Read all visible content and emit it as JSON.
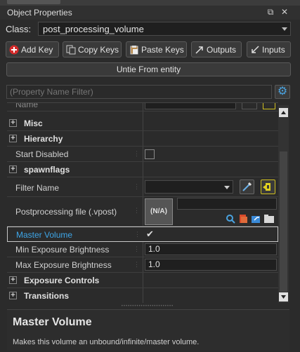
{
  "window": {
    "title": "Object Properties"
  },
  "class_row": {
    "label": "Class:",
    "value": "post_processing_volume"
  },
  "toolbar": {
    "add_key": "Add Key",
    "copy_keys": "Copy Keys",
    "paste_keys": "Paste Keys",
    "outputs": "Outputs",
    "inputs": "Inputs"
  },
  "untie_label": "Untie From entity",
  "filter": {
    "placeholder": "(Property Name Filter)"
  },
  "properties": {
    "cut_top_label": "Name",
    "misc": "Misc",
    "hierarchy": "Hierarchy",
    "start_disabled": "Start Disabled",
    "spawnflags": "spawnflags",
    "filter_name": "Filter Name",
    "postprocessing_file": "Postprocessing file (.vpost)",
    "postprocessing_preview": "(N/A)",
    "master_volume": "Master Volume",
    "min_exposure": "Min Exposure Brightness",
    "min_exposure_value": "1.0",
    "max_exposure": "Max Exposure Brightness",
    "max_exposure_value": "1.0",
    "exposure_controls": "Exposure Controls",
    "transitions": "Transitions"
  },
  "help": {
    "title": "Master Volume",
    "description": "Makes this volume an unbound/infinite/master volume."
  },
  "colors": {
    "selected_label": "#3ea6e8",
    "accent_gear": "#4aa3e0",
    "add_key_icon": "#d42a2a",
    "filter_pick_icon": "#e0d020"
  }
}
